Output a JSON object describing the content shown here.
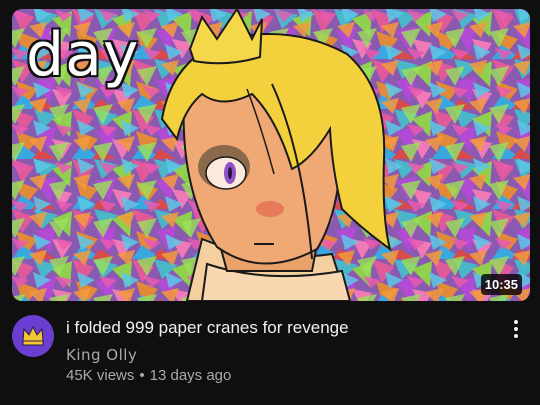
{
  "video": {
    "title": "i folded 999 paper cranes for revenge",
    "channel": "King Olly",
    "views": "45K views",
    "separator": "•",
    "age": "13 days ago",
    "duration": "10:35"
  },
  "thumbnail": {
    "overlay_text": "day"
  },
  "colors": {
    "background": "#0f0f0f",
    "title": "#f1f1f1",
    "secondary_text": "#aaaaaa",
    "avatar_bg": "#6a3ed1",
    "avatar_crown": "#f4c533"
  },
  "icons": {
    "menu": "more-vert-icon",
    "avatar": "crown-icon"
  }
}
